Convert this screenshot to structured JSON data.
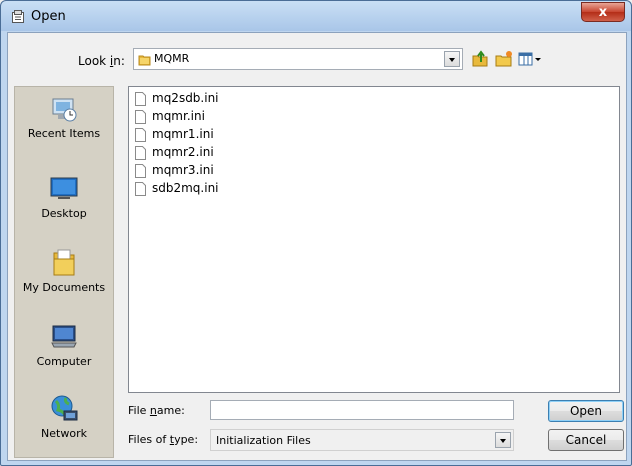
{
  "window": {
    "title": "Open",
    "close_glyph": "x"
  },
  "toolbar": {
    "lookin_label_pre": "Look ",
    "lookin_label_key": "i",
    "lookin_label_post": "n:",
    "lookin_value": "MQMR",
    "icons": [
      "up-folder-icon",
      "new-folder-icon",
      "view-menu-icon"
    ]
  },
  "places": [
    {
      "label": "Recent Items",
      "icon": "recent-items-icon"
    },
    {
      "label": "Desktop",
      "icon": "desktop-icon"
    },
    {
      "label": "My Documents",
      "icon": "my-documents-icon"
    },
    {
      "label": "Computer",
      "icon": "computer-icon"
    },
    {
      "label": "Network",
      "icon": "network-icon"
    }
  ],
  "files": [
    "mq2sdb.ini",
    "mqmr.ini",
    "mqmr1.ini",
    "mqmr2.ini",
    "mqmr3.ini",
    "sdb2mq.ini"
  ],
  "filename": {
    "label_pre": "File ",
    "label_key": "n",
    "label_post": "ame:",
    "value": ""
  },
  "filetype": {
    "label_pre": "Files of ",
    "label_key": "t",
    "label_post": "ype:",
    "value": "Initialization Files"
  },
  "buttons": {
    "open": "Open",
    "cancel": "Cancel"
  },
  "colors": {
    "title_bar": "#a9c6e8",
    "close": "#c7442f",
    "places_bg": "#d5d1c5",
    "folder": "#e8b93c"
  }
}
